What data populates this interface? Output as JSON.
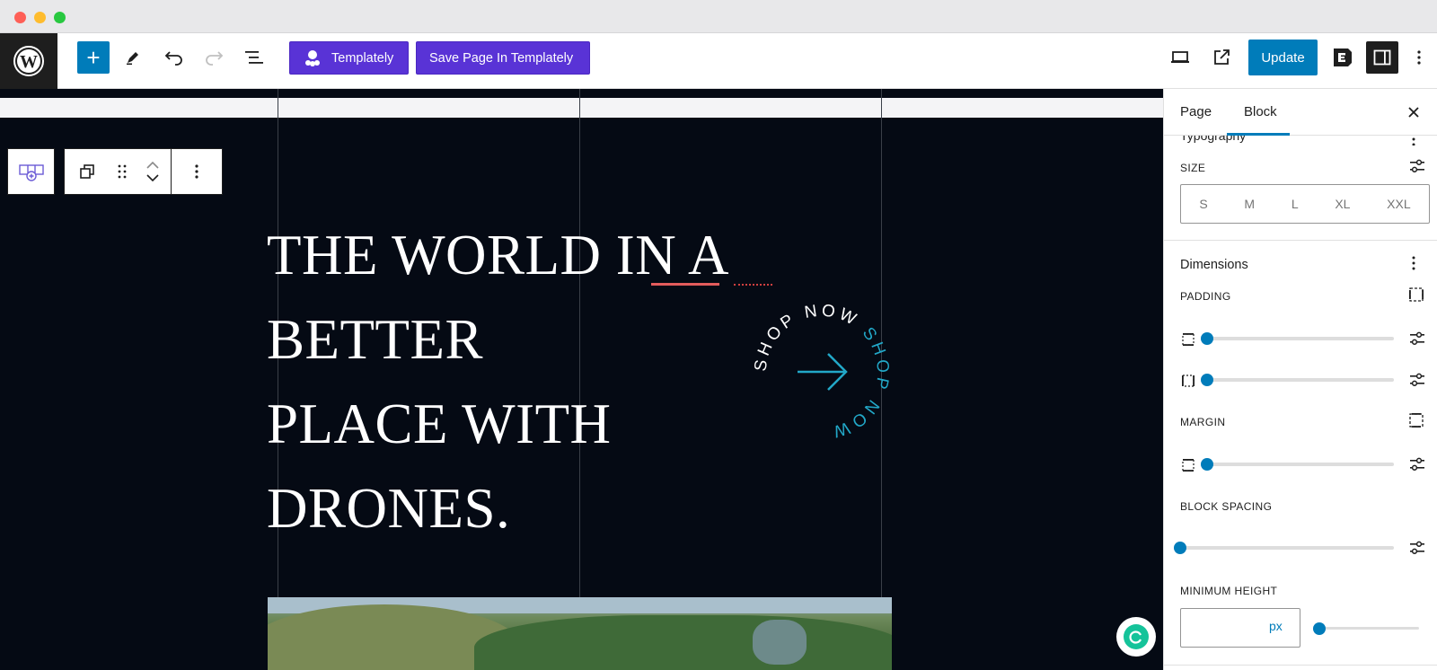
{
  "toolbar": {
    "templately_label": "Templately",
    "save_template_label": "Save Page In Templately",
    "update_label": "Update"
  },
  "canvas": {
    "headline_lines": [
      "THE WORLD IN A",
      "BETTER",
      "PLACE WITH",
      "DRONES."
    ],
    "badge_text": "SHOP NOW SHOP NOW",
    "colors": {
      "background": "#050a14",
      "accent": "#22a8c8",
      "underline": "#e45c5c"
    }
  },
  "sidebar": {
    "tabs": [
      {
        "label": "Page"
      },
      {
        "label": "Block"
      }
    ],
    "typography_title": "Typography",
    "size_label": "SIZE",
    "size_options": [
      "S",
      "M",
      "L",
      "XL",
      "XXL"
    ],
    "dimensions_title": "Dimensions",
    "padding_label": "PADDING",
    "margin_label": "MARGIN",
    "block_spacing_label": "BLOCK SPACING",
    "min_height_label": "MINIMUM HEIGHT",
    "min_height_unit": "px",
    "min_height_value": ""
  },
  "brand": {
    "wp_blue": "#007cba",
    "templately_purple": "#5933d6"
  }
}
